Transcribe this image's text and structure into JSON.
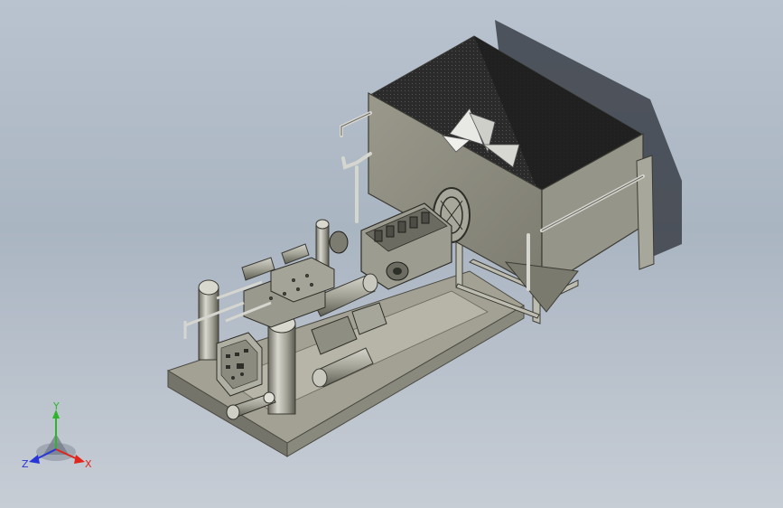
{
  "triad": {
    "x_label": "X",
    "y_label": "Y",
    "z_label": "Z",
    "x_color": "#e0261c",
    "y_color": "#2fb52c",
    "z_color": "#2836d8"
  },
  "colors": {
    "metal_light": "#b4b3a6",
    "metal_mid": "#8f8e80",
    "metal_dark": "#5c5b50",
    "hopper_inside": "#2a2a2a",
    "shadow": "#3a3f47",
    "pipe": "#d8d8d4"
  }
}
